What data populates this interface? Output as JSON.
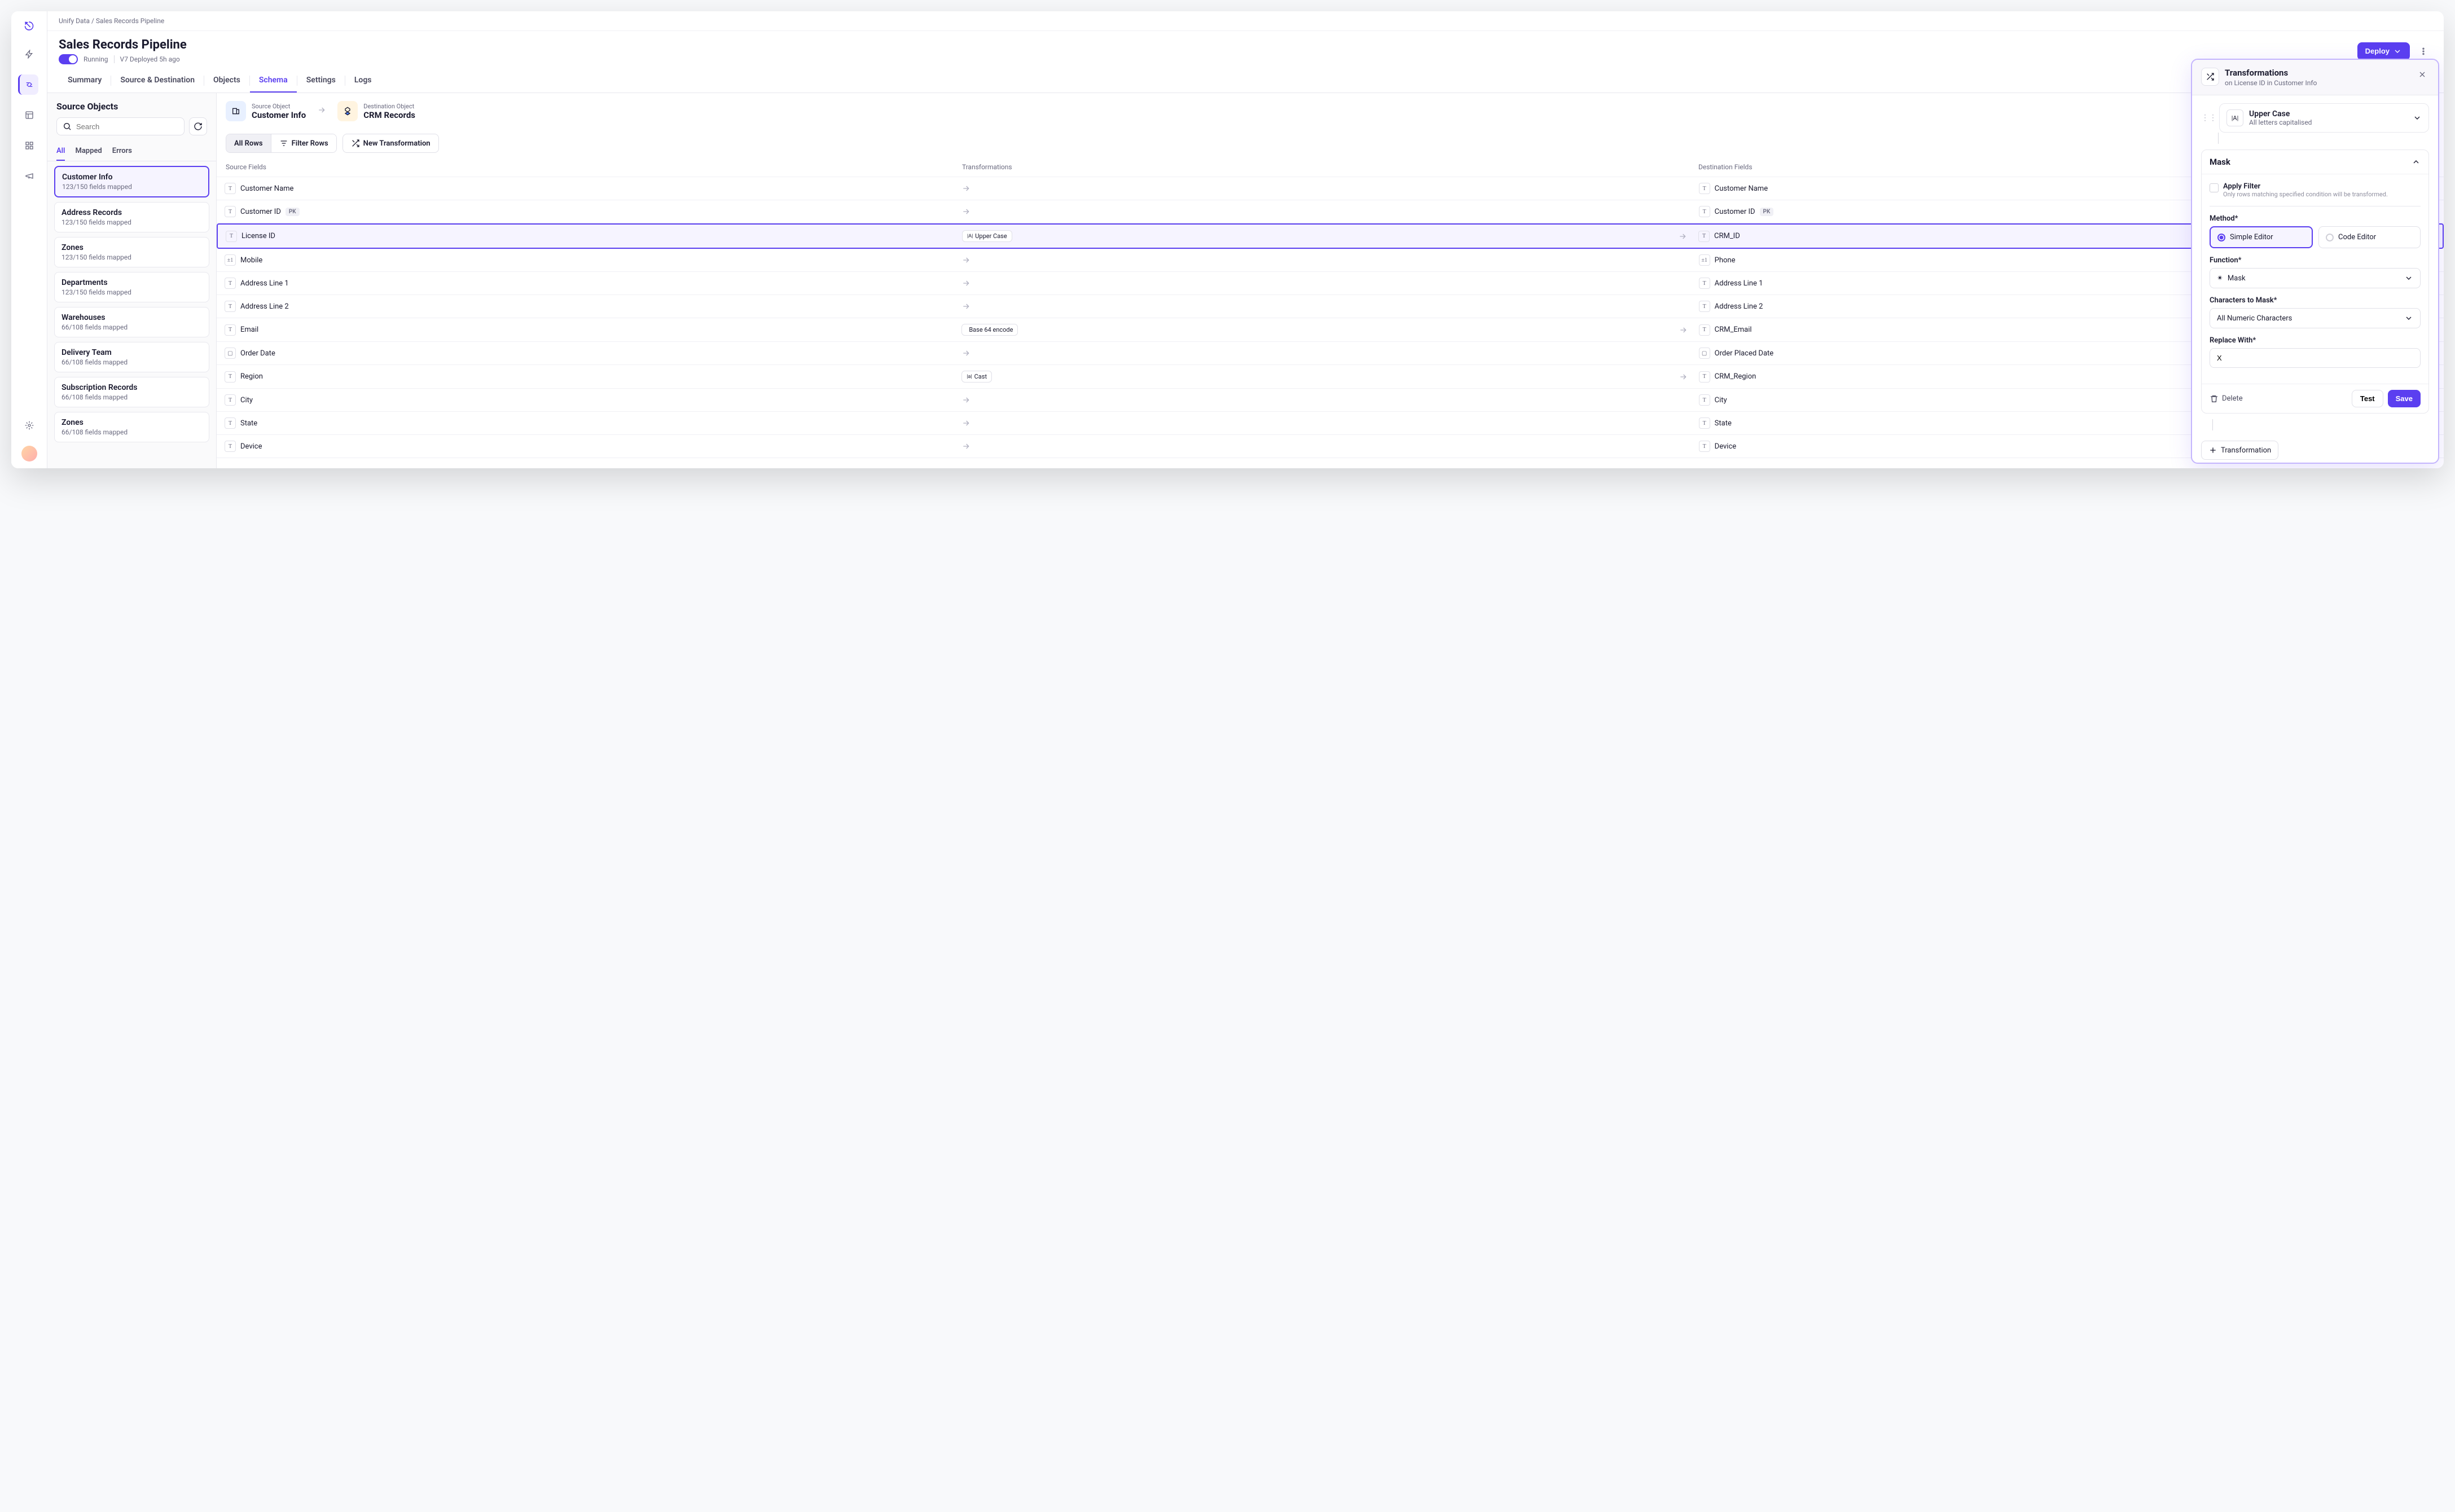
{
  "breadcrumb": {
    "root": "Unify Data",
    "current": "Sales Records Pipeline"
  },
  "header": {
    "title": "Sales Records Pipeline",
    "running": "Running",
    "version": "V7 Deployed 5h ago",
    "deploy": "Deploy"
  },
  "tabs": [
    "Summary",
    "Source & Destination",
    "Objects",
    "Schema",
    "Settings",
    "Logs"
  ],
  "active_tab": 3,
  "sidebar": {
    "title": "Source Objects",
    "search_placeholder": "Search",
    "filters": [
      "All",
      "Mapped",
      "Errors"
    ],
    "active_filter": 0,
    "items": [
      {
        "name": "Customer Info",
        "meta": "123/150 fields mapped",
        "selected": true
      },
      {
        "name": "Address Records",
        "meta": "123/150 fields mapped"
      },
      {
        "name": "Zones",
        "meta": "123/150 fields mapped"
      },
      {
        "name": "Departments",
        "meta": "123/150 fields mapped"
      },
      {
        "name": "Warehouses",
        "meta": "66/108 fields mapped"
      },
      {
        "name": "Delivery Team",
        "meta": "66/108 fields mapped"
      },
      {
        "name": "Subscription Records",
        "meta": "66/108 fields mapped"
      },
      {
        "name": "Zones",
        "meta": "66/108 fields mapped"
      }
    ]
  },
  "mapping": {
    "source_label": "Source Object",
    "source_name": "Customer Info",
    "dest_label": "Destination Object",
    "dest_name": "CRM Records",
    "seg_all": "All Rows",
    "seg_filter": "Filter Rows",
    "new_t": "New Transformation",
    "col_src": "Source Fields",
    "col_trans": "Transformations",
    "col_dst": "Destination Fields",
    "rows": [
      {
        "src": "Customer Name",
        "src_t": "T",
        "dst": "Customer Name",
        "dst_t": "T"
      },
      {
        "src": "Customer ID",
        "src_t": "T",
        "src_pk": true,
        "dst": "Customer ID",
        "dst_t": "T",
        "dst_pk": true
      },
      {
        "src": "License ID",
        "src_t": "T",
        "chip": "Upper Case",
        "chip_icon": "|A|",
        "dst": "CRM_ID",
        "dst_t": "T",
        "selected": true
      },
      {
        "src": "Mobile",
        "src_t": "±1",
        "dst": "Phone",
        "dst_t": "±1"
      },
      {
        "src": "Address Line 1",
        "src_t": "T",
        "dst": "Address Line 1",
        "dst_t": "T"
      },
      {
        "src": "Address Line 2",
        "src_t": "T",
        "dst": "Address Line 2",
        "dst_t": "T"
      },
      {
        "src": "Email",
        "src_t": "T",
        "chip": "Base 64 encode",
        "chip_icon": "</>",
        "dst": "CRM_Email",
        "dst_t": "T"
      },
      {
        "src": "Order Date",
        "src_t": "▢",
        "dst": "Order Placed Date",
        "dst_t": "▢"
      },
      {
        "src": "Region",
        "src_t": "T",
        "chip": "Cast",
        "chip_icon": "|a|",
        "dst": "CRM_Region",
        "dst_t": "T"
      },
      {
        "src": "City",
        "src_t": "T",
        "dst": "City",
        "dst_t": "T"
      },
      {
        "src": "State",
        "src_t": "T",
        "dst": "State",
        "dst_t": "T"
      },
      {
        "src": "Device",
        "src_t": "T",
        "dst": "Device",
        "dst_t": "T"
      }
    ]
  },
  "panel": {
    "title": "Transformations",
    "subtitle": "on License ID in Customer Info",
    "card1_title": "Upper Case",
    "card1_sub": "All letters capitalised",
    "mask_title": "Mask",
    "apply_filter": "Apply Filter",
    "apply_hint": "Only rows matching specified condition will be transformed.",
    "method_label": "Method*",
    "method_simple": "Simple Editor",
    "method_code": "Code Editor",
    "function_label": "Function*",
    "function_value": "Mask",
    "chars_label": "Characters to Mask*",
    "chars_value": "All Numeric Characters",
    "replace_label": "Replace With*",
    "replace_value": "X",
    "delete": "Delete",
    "test": "Test",
    "save": "Save",
    "add_t": "Transformation"
  }
}
